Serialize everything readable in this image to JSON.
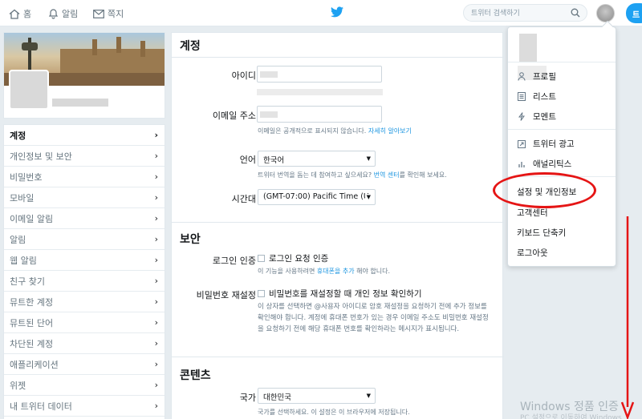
{
  "topnav": {
    "home": "홈",
    "notifications": "알림",
    "messages": "쪽지",
    "search_placeholder": "트위터 검색하기",
    "tweet_button": "트"
  },
  "sidebar": {
    "items": [
      {
        "label": "계정",
        "active": true
      },
      {
        "label": "개인정보 및 보안"
      },
      {
        "label": "비밀번호"
      },
      {
        "label": "모바일"
      },
      {
        "label": "이메일 알림"
      },
      {
        "label": "알림"
      },
      {
        "label": "웹 알림"
      },
      {
        "label": "친구 찾기"
      },
      {
        "label": "뮤트한 계정"
      },
      {
        "label": "뮤트된 단어"
      },
      {
        "label": "차단된 계정"
      },
      {
        "label": "애플리케이션"
      },
      {
        "label": "위젯"
      },
      {
        "label": "내 트위터 데이터"
      }
    ],
    "chevron": "›"
  },
  "main": {
    "account_title": "계정",
    "username_label": "아이디",
    "email_label": "이메일 주소",
    "email_help": "이메일은 공개적으로 표시되지 않습니다.",
    "email_help_link": "자세히 알아보기",
    "language_label": "언어",
    "language_value": "한국어",
    "language_help_pre": "트위터 번역을 돕는 데 참여하고 싶으세요?",
    "language_help_link": "번역 센터",
    "language_help_post": "를 확인해 보세요.",
    "timezone_label": "시간대",
    "timezone_value": "(GMT-07:00) Pacific Time (U",
    "security_title": "보안",
    "login_verification_label": "로그인 인증",
    "login_verification_checkbox": "로그인 요청 인증",
    "login_verification_help_pre": "이 기능을 사용하려면",
    "login_verification_help_link": "휴대폰을 추가",
    "login_verification_help_post": "해야 합니다.",
    "password_reset_label": "비밀번호 재설정",
    "password_reset_checkbox": "비밀번호를 재설정할 때 개인 정보 확인하기",
    "password_reset_help": "이 상자를 선택하면 @사용자 아이디로 암호 재설정을 요청하기 전에 추가 정보를 확인해야 합니다. 계정에 휴대폰 번호가 있는 경우 이메일 주소도 비밀번호 재설정을 요청하기 전에 해당 휴대폰 번호를 확인하라는 메시지가 표시됩니다.",
    "content_title": "콘텐츠",
    "country_label": "국가",
    "country_value": "대한민국",
    "country_help": "국가를 선택하세요. 이 설정은 이 브라우저에 저장됩니다."
  },
  "dropdown": {
    "items": [
      {
        "label": "프로필",
        "icon": "person-icon"
      },
      {
        "label": "리스트",
        "icon": "list-icon"
      },
      {
        "label": "모멘트",
        "icon": "lightning-icon"
      },
      {
        "label": "트위터 광고",
        "icon": "external-link-icon"
      },
      {
        "label": "애널리틱스",
        "icon": "bar-chart-icon"
      }
    ],
    "settings": "설정 및 개인정보",
    "help_center": "고객센터",
    "keyboard_shortcuts": "키보드 단축키",
    "logout": "로그아웃"
  },
  "watermark": {
    "line1": "Windows 정품 인증",
    "line2": "PC 설정으로 이동하여 Windows"
  },
  "colors": {
    "accent": "#1da1f2",
    "link": "#1b95e0",
    "annotation_red": "#e51515"
  }
}
